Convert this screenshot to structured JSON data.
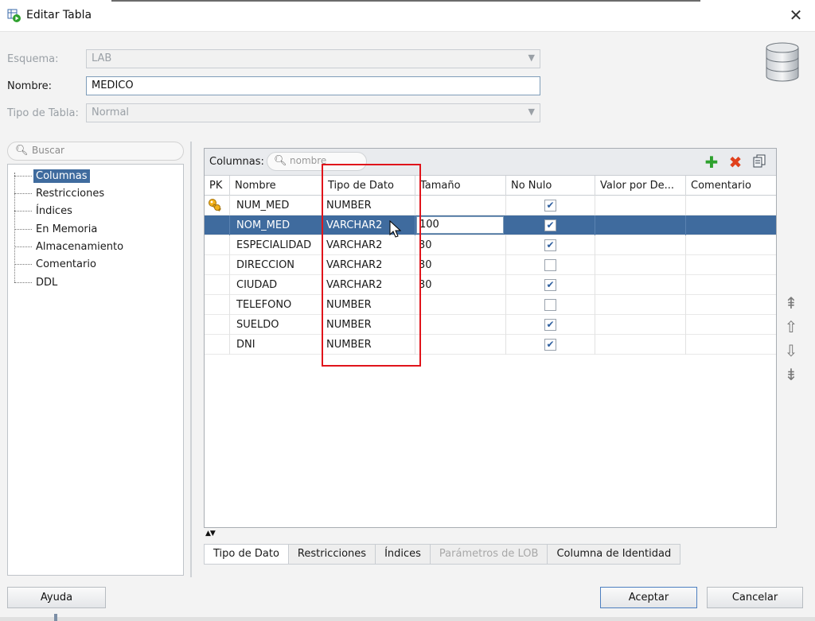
{
  "window": {
    "title": "Editar Tabla",
    "close_glyph": "✕"
  },
  "form": {
    "schema_label": "Esquema:",
    "schema_value": "LAB",
    "name_label": "Nombre:",
    "name_value": "MEDICO",
    "table_type_label": "Tipo de Tabla:",
    "table_type_value": "Normal"
  },
  "nav": {
    "search_placeholder": "Buscar",
    "items": [
      {
        "label": "Columnas",
        "selected": true
      },
      {
        "label": "Restricciones"
      },
      {
        "label": "Índices"
      },
      {
        "label": "En Memoria"
      },
      {
        "label": "Almacenamiento"
      },
      {
        "label": "Comentario"
      },
      {
        "label": "DDL"
      }
    ]
  },
  "columns_panel": {
    "label": "Columnas:",
    "filter_placeholder": "nombre",
    "toolbar": {
      "add_icon": "add-icon",
      "delete_icon": "delete-icon",
      "copy_icon": "copy-icon"
    },
    "headers": {
      "pk": "PK",
      "name": "Nombre",
      "datatype": "Tipo de Dato",
      "size": "Tamaño",
      "not_null": "No Nulo",
      "default": "Valor por De...",
      "comment": "Comentario"
    },
    "rows": [
      {
        "pk": true,
        "name": "NUM_MED",
        "datatype": "NUMBER",
        "size": "",
        "not_null": true
      },
      {
        "pk": false,
        "name": "NOM_MED",
        "datatype": "VARCHAR2",
        "size": "100",
        "not_null": true,
        "selected": true
      },
      {
        "pk": false,
        "name": "ESPECIALIDAD",
        "datatype": "VARCHAR2",
        "size": "30",
        "not_null": true
      },
      {
        "pk": false,
        "name": "DIRECCION",
        "datatype": "VARCHAR2",
        "size": "30",
        "not_null": false
      },
      {
        "pk": false,
        "name": "CIUDAD",
        "datatype": "VARCHAR2",
        "size": "30",
        "not_null": true
      },
      {
        "pk": false,
        "name": "TELEFONO",
        "datatype": "NUMBER",
        "size": "",
        "not_null": false
      },
      {
        "pk": false,
        "name": "SUELDO",
        "datatype": "NUMBER",
        "size": "",
        "not_null": true
      },
      {
        "pk": false,
        "name": "DNI",
        "datatype": "NUMBER",
        "size": "",
        "not_null": true
      }
    ]
  },
  "bottom_tabs": [
    {
      "label": "Tipo de Dato",
      "state": "active"
    },
    {
      "label": "Restricciones",
      "state": "normal"
    },
    {
      "label": "Índices",
      "state": "normal"
    },
    {
      "label": "Parámetros de LOB",
      "state": "disabled"
    },
    {
      "label": "Columna de Identidad",
      "state": "normal"
    }
  ],
  "buttons": {
    "help": "Ayuda",
    "ok": "Aceptar",
    "cancel": "Cancelar"
  },
  "colors": {
    "selection": "#3f6b9e",
    "highlight_box": "#e0141b",
    "add": "#2ea12e",
    "delete": "#e0401c"
  }
}
